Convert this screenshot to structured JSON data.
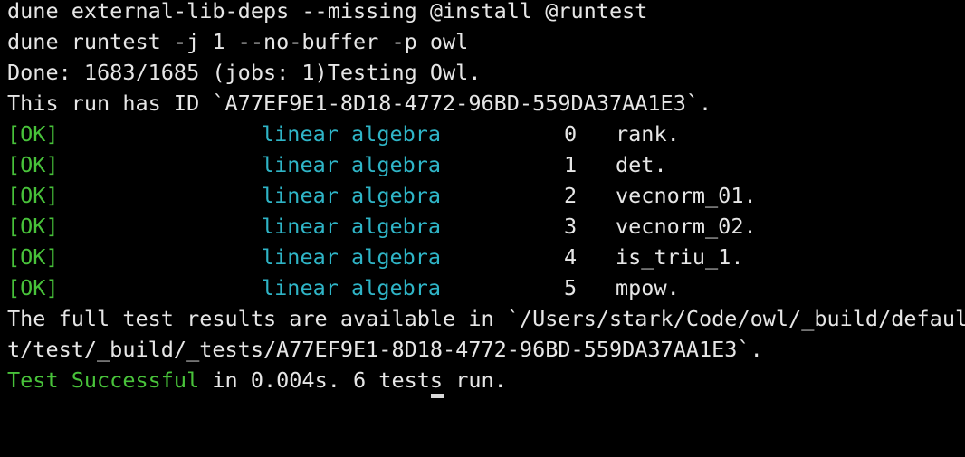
{
  "terminal": {
    "lines": {
      "cmd1": "dune external-lib-deps --missing @install @runtest",
      "cmd2": "dune runtest -j 1 --no-buffer -p owl",
      "done": "Done: 1683/1685 (jobs: 1)Testing Owl.",
      "run_id": "This run has ID `A77EF9E1-8D18-4772-96BD-559DA37AA1E3`.",
      "results_1": "The full test results are available in `/Users/stark/Code/owl/_build/defaul",
      "results_2": "t/test/_build/_tests/A77EF9E1-8D18-4772-96BD-559DA37AA1E3`."
    },
    "tests": [
      {
        "status": "[OK]",
        "suite": "linear algebra",
        "index": "0",
        "name": "rank."
      },
      {
        "status": "[OK]",
        "suite": "linear algebra",
        "index": "1",
        "name": "det."
      },
      {
        "status": "[OK]",
        "suite": "linear algebra",
        "index": "2",
        "name": "vecnorm_01."
      },
      {
        "status": "[OK]",
        "suite": "linear algebra",
        "index": "3",
        "name": "vecnorm_02."
      },
      {
        "status": "[OK]",
        "suite": "linear algebra",
        "index": "4",
        "name": "is_triu_1."
      },
      {
        "status": "[OK]",
        "suite": "linear algebra",
        "index": "5",
        "name": "mpow."
      }
    ],
    "summary": {
      "success": "Test Successful",
      "rest": " in 0.004s. 6 tests run."
    },
    "colors": {
      "background": "#000000",
      "text": "#e6e6e6",
      "ok": "#48c23a",
      "suite": "#2fb5c7"
    }
  }
}
